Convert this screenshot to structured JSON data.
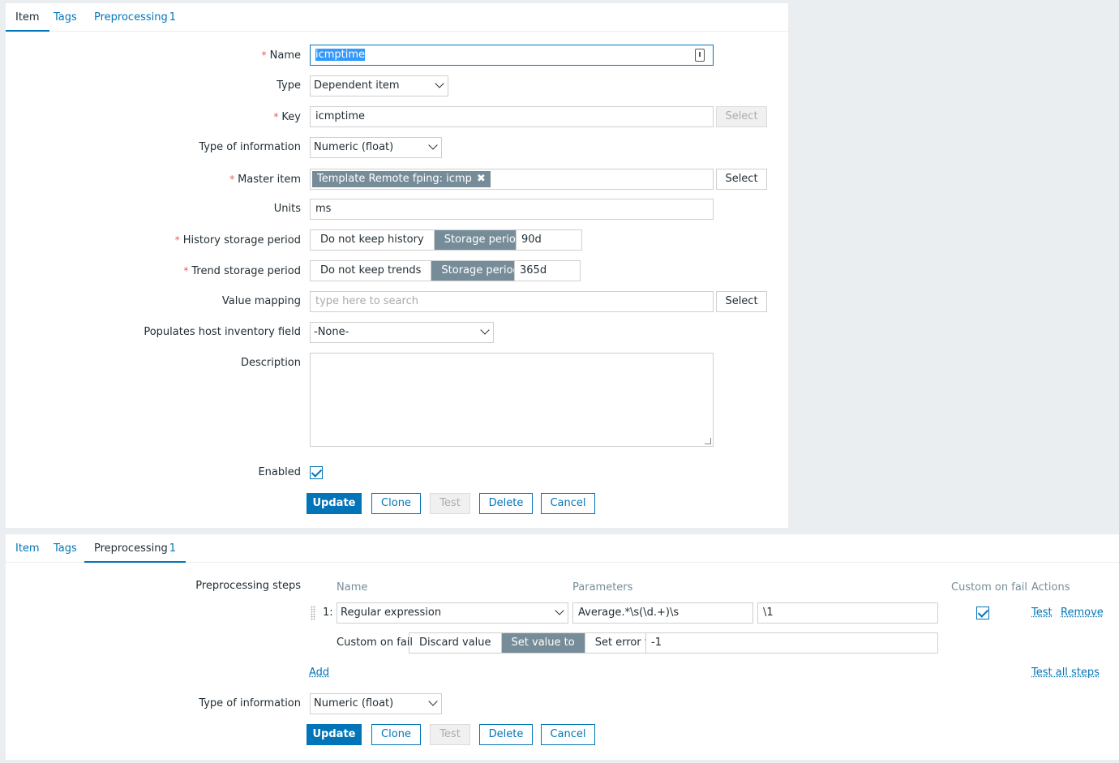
{
  "top_tabs": {
    "item": "Item",
    "tags": "Tags",
    "preprocessing": "Preprocessing",
    "preprocessing_count": "1"
  },
  "form": {
    "name": {
      "label": "Name",
      "value": "icmptime"
    },
    "type": {
      "label": "Type",
      "value": "Dependent item"
    },
    "key": {
      "label": "Key",
      "value": "icmptime",
      "select": "Select"
    },
    "type_of_information": {
      "label": "Type of information",
      "value": "Numeric (float)"
    },
    "master_item": {
      "label": "Master item",
      "chip": "Template Remote fping: icmp",
      "select": "Select"
    },
    "units": {
      "label": "Units",
      "value": "ms"
    },
    "history": {
      "label": "History storage period",
      "opt1": "Do not keep history",
      "opt2": "Storage period",
      "value": "90d"
    },
    "trend": {
      "label": "Trend storage period",
      "opt1": "Do not keep trends",
      "opt2": "Storage period",
      "value": "365d"
    },
    "value_mapping": {
      "label": "Value mapping",
      "placeholder": "type here to search",
      "select": "Select"
    },
    "inventory": {
      "label": "Populates host inventory field",
      "value": "-None-"
    },
    "description": {
      "label": "Description"
    },
    "enabled": {
      "label": "Enabled"
    }
  },
  "buttons": {
    "update": "Update",
    "clone": "Clone",
    "test": "Test",
    "delete": "Delete",
    "cancel": "Cancel"
  },
  "preprocessing": {
    "label": "Preprocessing steps",
    "columns": {
      "name": "Name",
      "parameters": "Parameters",
      "custom_on_fail": "Custom on fail",
      "actions": "Actions"
    },
    "step": {
      "number": "1:",
      "name": "Regular expression",
      "param1": "Average.*\\s(\\d.+)\\s",
      "param2": "\\1",
      "test": "Test",
      "remove": "Remove"
    },
    "custom_on_fail": {
      "label": "Custom on fail",
      "opt1": "Discard value",
      "opt2": "Set value to",
      "opt3": "Set error to",
      "value": "-1"
    },
    "add": "Add",
    "test_all": "Test all steps",
    "type_of_information": {
      "label": "Type of information",
      "value": "Numeric (float)"
    }
  }
}
